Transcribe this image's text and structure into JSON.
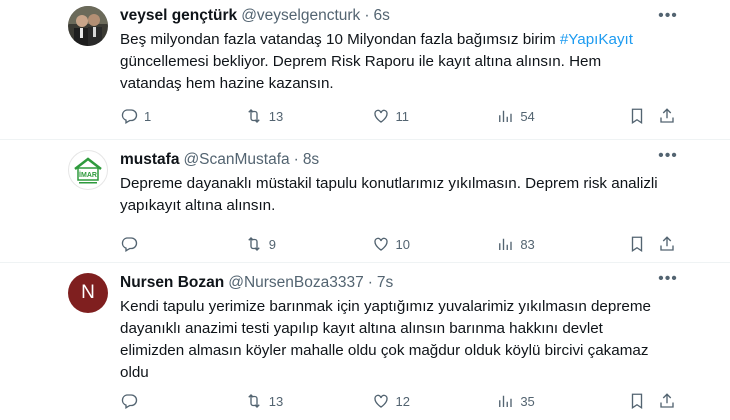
{
  "tweets": [
    {
      "name": "veysel gençtürk",
      "handle": "@veyselgencturk",
      "dot": "·",
      "time": "6s",
      "text_before": "Beş milyondan fazla vatandaş 10 Milyondan fazla bağımsız birim ",
      "hashtag": "#YapıKayıt",
      "text_after": "güncellemesi bekliyor. Deprem Risk Raporu ile kayıt altına alınsın. Hem vatandaş hem hazine kazansın.",
      "replies": "1",
      "retweets": "13",
      "likes": "11",
      "views": "54"
    },
    {
      "name": "mustafa",
      "handle": "@ScanMustafa",
      "dot": "·",
      "time": "8s",
      "avatar_text": "İMAR",
      "text": "Depreme dayanaklı müstakil tapulu konutlarımız yıkılmasın. Deprem risk analizli yapıkayıt altına alınsın.",
      "replies": "",
      "retweets": "9",
      "likes": "10",
      "views": "83"
    },
    {
      "name": "Nursen Bozan",
      "handle": "@NursenBoza3337",
      "dot": "·",
      "time": "7s",
      "avatar_initial": "N",
      "text": "Kendi tapulu yerimize barınmak için yaptığımız yuvalarimiz yıkılmasın depreme dayanıklı anazimi testi yapılıp kayıt altına alınsın barınma hakkını devlet elimizden almasın köyler mahalle oldu çok mağdur olduk köylü bircivi çakamaz oldu",
      "replies": "",
      "retweets": "13",
      "likes": "12",
      "views": "35"
    }
  ],
  "colors": {
    "text": "#0f1419",
    "muted": "#536471",
    "link": "#1d9bf0",
    "divider": "#eff3f4",
    "avatar_n_bg": "#7f1f1f",
    "imar_green": "#2e9a3c"
  },
  "icons": [
    "reply-icon",
    "retweet-icon",
    "like-icon",
    "views-icon",
    "bookmark-icon",
    "share-icon",
    "more-icon"
  ]
}
